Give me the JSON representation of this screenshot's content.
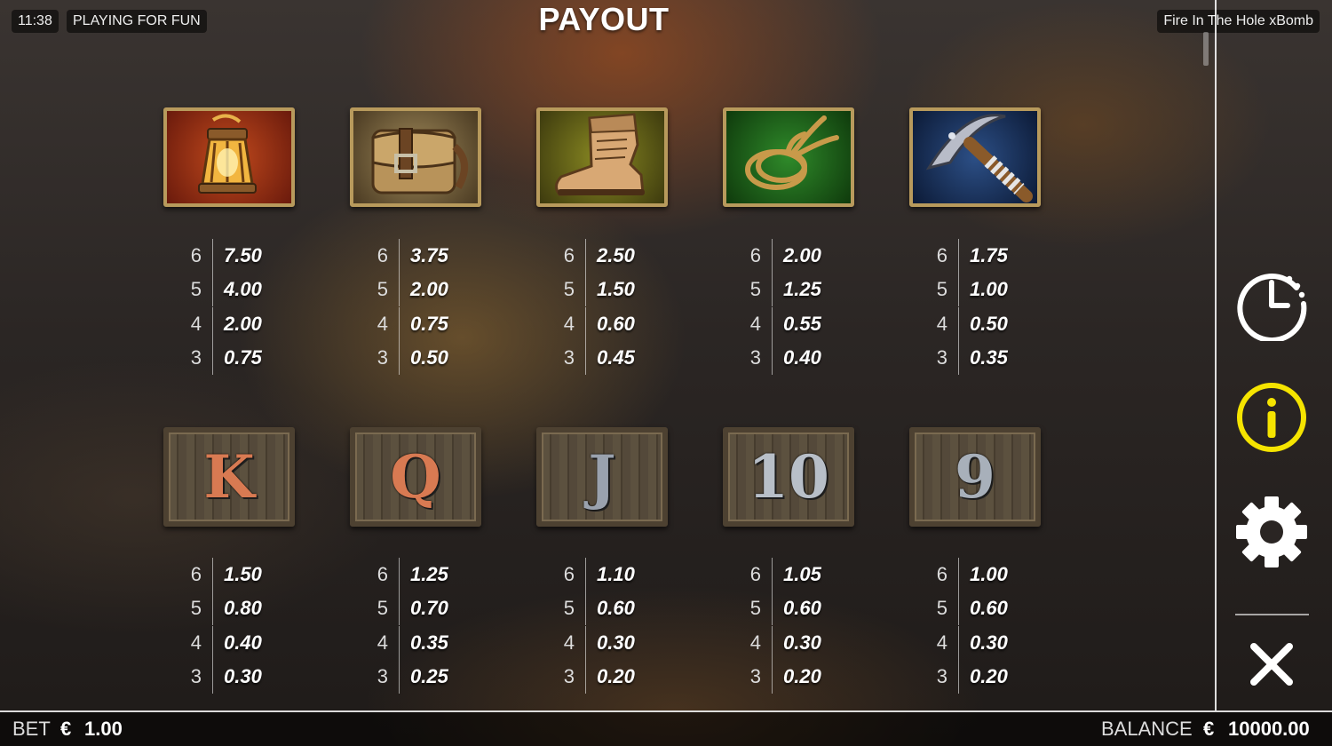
{
  "header": {
    "time": "11:38",
    "mode": "PLAYING FOR FUN",
    "title": "PAYOUT",
    "game_name": "Fire In The Hole xBomb"
  },
  "side_menu": {
    "history_icon": "history-clock-icon",
    "info_icon": "info-icon",
    "settings_icon": "gear-icon",
    "close_icon": "close-icon",
    "info_color": "#f5e400"
  },
  "symbols": [
    {
      "name": "lantern",
      "pays": [
        {
          "count": "6",
          "value": "7.50"
        },
        {
          "count": "5",
          "value": "4.00"
        },
        {
          "count": "4",
          "value": "2.00"
        },
        {
          "count": "3",
          "value": "0.75"
        }
      ]
    },
    {
      "name": "satchel",
      "pays": [
        {
          "count": "6",
          "value": "3.75"
        },
        {
          "count": "5",
          "value": "2.00"
        },
        {
          "count": "4",
          "value": "0.75"
        },
        {
          "count": "3",
          "value": "0.50"
        }
      ]
    },
    {
      "name": "boot",
      "pays": [
        {
          "count": "6",
          "value": "2.50"
        },
        {
          "count": "5",
          "value": "1.50"
        },
        {
          "count": "4",
          "value": "0.60"
        },
        {
          "count": "3",
          "value": "0.45"
        }
      ]
    },
    {
      "name": "rope",
      "pays": [
        {
          "count": "6",
          "value": "2.00"
        },
        {
          "count": "5",
          "value": "1.25"
        },
        {
          "count": "4",
          "value": "0.55"
        },
        {
          "count": "3",
          "value": "0.40"
        }
      ]
    },
    {
      "name": "pickaxe",
      "pays": [
        {
          "count": "6",
          "value": "1.75"
        },
        {
          "count": "5",
          "value": "1.00"
        },
        {
          "count": "4",
          "value": "0.50"
        },
        {
          "count": "3",
          "value": "0.35"
        }
      ]
    },
    {
      "name": "K",
      "label": "K",
      "pays": [
        {
          "count": "6",
          "value": "1.50"
        },
        {
          "count": "5",
          "value": "0.80"
        },
        {
          "count": "4",
          "value": "0.40"
        },
        {
          "count": "3",
          "value": "0.30"
        }
      ]
    },
    {
      "name": "Q",
      "label": "Q",
      "pays": [
        {
          "count": "6",
          "value": "1.25"
        },
        {
          "count": "5",
          "value": "0.70"
        },
        {
          "count": "4",
          "value": "0.35"
        },
        {
          "count": "3",
          "value": "0.25"
        }
      ]
    },
    {
      "name": "J",
      "label": "J",
      "pays": [
        {
          "count": "6",
          "value": "1.10"
        },
        {
          "count": "5",
          "value": "0.60"
        },
        {
          "count": "4",
          "value": "0.30"
        },
        {
          "count": "3",
          "value": "0.20"
        }
      ]
    },
    {
      "name": "10",
      "label": "10",
      "pays": [
        {
          "count": "6",
          "value": "1.05"
        },
        {
          "count": "5",
          "value": "0.60"
        },
        {
          "count": "4",
          "value": "0.30"
        },
        {
          "count": "3",
          "value": "0.20"
        }
      ]
    },
    {
      "name": "9",
      "label": "9",
      "pays": [
        {
          "count": "6",
          "value": "1.00"
        },
        {
          "count": "5",
          "value": "0.60"
        },
        {
          "count": "4",
          "value": "0.30"
        },
        {
          "count": "3",
          "value": "0.20"
        }
      ]
    }
  ],
  "footer": {
    "bet_label": "BET",
    "bet_currency": "€",
    "bet_value": "1.00",
    "balance_label": "BALANCE",
    "balance_currency": "€",
    "balance_value": "10000.00"
  }
}
